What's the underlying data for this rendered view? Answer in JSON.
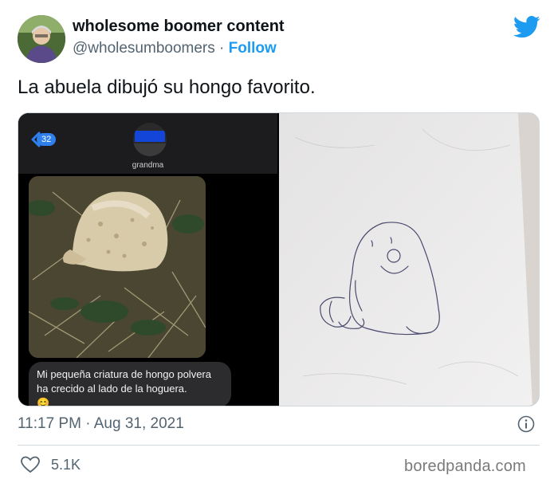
{
  "tweet": {
    "display_name": "wholesome boomer content",
    "handle": "@wholesumboomers",
    "separator": "·",
    "follow_label": "Follow",
    "text": "La abuela dibujó su hongo favorito.",
    "timestamp": "11:17 PM · Aug 31, 2021",
    "likes": "5.1K",
    "brand_color": "#1d9bf0"
  },
  "screenshot": {
    "back_count": "32",
    "contact_name": "grandma",
    "message": "Mi pequeña criatura de hongo polvera ha crecido al lado de la hoguera.",
    "emoji": "😊"
  },
  "watermark": "boredpanda.com",
  "icons": {
    "logo": "twitter-bird-icon",
    "info": "info-icon",
    "like": "heart-icon",
    "back": "chevron-left-icon"
  }
}
